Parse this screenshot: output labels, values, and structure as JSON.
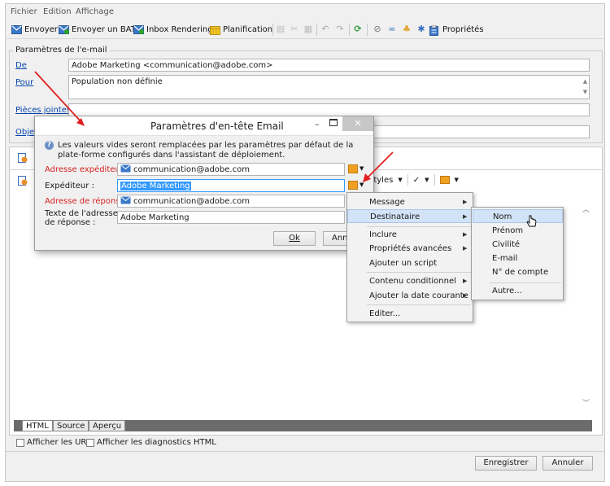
{
  "menubar": {
    "file": "Fichier",
    "edit": "Edition",
    "view": "Affichage"
  },
  "toolbar": {
    "send": "Envoyer",
    "send_proof": "Envoyer un BAT",
    "inbox_rendering": "Inbox Rendering",
    "scheduling": "Planification",
    "properties": "Propriétés"
  },
  "email_params": {
    "group_label": "Paramètres de l'e-mail",
    "from_label": "De",
    "from_value": "Adobe Marketing <communication@adobe.com>",
    "to_label": "Pour",
    "to_value": "Population non définie",
    "attachments_label": "Pièces jointes",
    "subject_label": "Objet"
  },
  "dialog": {
    "title": "Paramètres d'en-tête Email",
    "info_line1": "Les valeurs vides seront remplacées par les paramètres par défaut de la",
    "info_line2": "plate-forme configurés dans l'assistant de déploiement.",
    "sender_address_label": "Adresse expéditeur :",
    "sender_address_value": "communication@adobe.com",
    "sender_label": "Expéditeur :",
    "sender_value": "Adobe Marketing",
    "reply_address_label": "Adresse de réponse :",
    "reply_address_value": "communication@adobe.com",
    "reply_text_label_line1": "Texte de l'adresse",
    "reply_text_label_line2": "de réponse :",
    "reply_text_value": "Adobe Marketing",
    "ok_label": "Ok",
    "cancel_label": "Ann"
  },
  "editor": {
    "styles_label": "Styles"
  },
  "context_menu": {
    "items": [
      "Message",
      "Destinataire",
      "Inclure",
      "Propriétés avancées",
      "Ajouter un script",
      "Contenu conditionnel",
      "Ajouter la date courante",
      "Editer..."
    ]
  },
  "submenu": {
    "items": [
      "Nom",
      "Prénom",
      "Civilité",
      "E-mail",
      "N° de compte",
      "Autre..."
    ]
  },
  "bottom_tabs": {
    "html": "HTML",
    "source": "Source",
    "preview": "Aperçu"
  },
  "options": {
    "show_urls": "Afficher les URL",
    "show_diagnostics": "Afficher les diagnostics HTML"
  },
  "footer": {
    "save": "Enregistrer",
    "cancel": "Annuler"
  },
  "colors": {
    "accent_blue": "#3399ff",
    "link_blue": "#0645ad",
    "red_label": "#d42020",
    "menu_highlight": "#d3e3f7"
  }
}
